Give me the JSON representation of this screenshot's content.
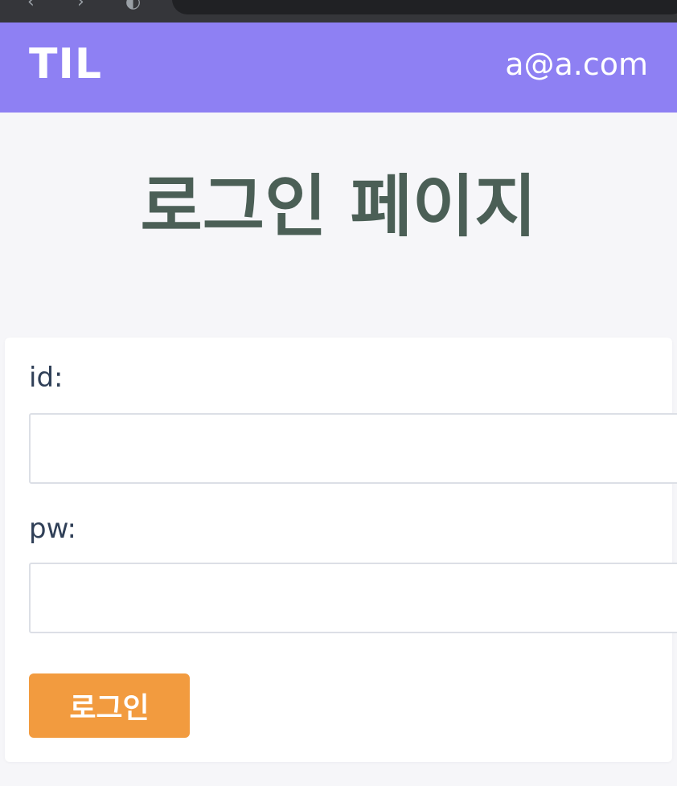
{
  "browser": {
    "back_glyph": "‹",
    "forward_glyph": "›",
    "reload_glyph": "◐",
    "url_text": ""
  },
  "header": {
    "brand": "TIL",
    "user_email": "a@a.com",
    "background_color": "#8e80f3"
  },
  "main": {
    "title": "로그인 페이지"
  },
  "login_form": {
    "id_label": "id:",
    "id_value": "",
    "pw_label": "pw:",
    "pw_value": "",
    "submit_label": "로그인",
    "submit_color": "#f29b3f"
  }
}
